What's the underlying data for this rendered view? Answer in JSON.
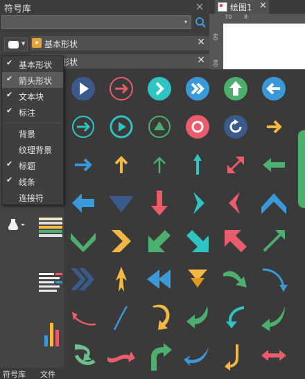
{
  "panel": {
    "title": "符号库",
    "close": "✕"
  },
  "search": {
    "placeholder": "",
    "dropdown": "▾"
  },
  "libraries": [
    {
      "label": "基本形状",
      "close": "✕"
    },
    {
      "label": "箭头形状",
      "close": "✕"
    }
  ],
  "menu": {
    "items": [
      {
        "label": "基本形状",
        "check": "✔"
      },
      {
        "label": "箭头形状",
        "check": "✔"
      },
      {
        "label": "文本块",
        "check": "✔"
      },
      {
        "label": "标注",
        "check": "✔"
      },
      {
        "label": "背景",
        "check": ""
      },
      {
        "label": "纹理背景",
        "check": ""
      },
      {
        "label": "标题",
        "check": "✔"
      },
      {
        "label": "线条",
        "check": "✔"
      },
      {
        "label": "连接符",
        "check": ""
      }
    ]
  },
  "doc": {
    "tab_label": "绘图1",
    "tab_close": "✕",
    "ruler_top": [
      "70",
      "8"
    ],
    "ruler_left": [
      "60",
      "80"
    ]
  },
  "bottom_tabs": [
    "符号库",
    "文件"
  ],
  "colors": {
    "teal": "#2ec4c4",
    "red": "#e85c6c",
    "green": "#4caf6e",
    "blue": "#3a9ad9",
    "yellow": "#f4b942",
    "navy": "#3a5a8c"
  },
  "symbols": [
    "play-circle-icon",
    "chevron-right-circle-outline-icon",
    "chevron-right-circle-icon",
    "double-chevron-circle-icon",
    "arrow-up-circle-icon",
    "arrow-left-circle-icon",
    "arrow-right-circle-outline-icon",
    "play-circle-outline-icon",
    "triangle-up-circle-icon",
    "refresh-circle-icon",
    "rotate-circle-icon",
    "chevron-right-icon",
    "arrow-right-icon",
    "arrow-up-icon",
    "arrow-up-thin-icon",
    "arrow-up-double-ended-icon",
    "arrow-diagonal-double-icon",
    "arrow-left-bold-icon",
    "arrow-left-block-icon",
    "triangle-down-icon",
    "arrow-down-block-icon",
    "chevron-right-thin-icon",
    "chevron-left-thin-icon",
    "chevron-up-block-icon",
    "chevron-down-block-icon",
    "chevron-right-block-icon",
    "arrow-down-left-block-icon",
    "arrow-down-right-block-icon",
    "arrow-up-left-block-icon",
    "arrow-up-right-thin-icon",
    "double-chevron-right-icon",
    "arrow-up-spike-icon",
    "double-triangle-left-icon",
    "triangle-down-double-icon",
    "curved-arrow-down-right-icon",
    "curved-arrow-down-thin-icon",
    "curved-arrow-left-icon",
    "curved-line-up-icon",
    "uturn-arrow-icon",
    "curved-arrow-down-left-icon",
    "curved-arrow-left-teal-icon",
    "curved-arrow-down-left-green-icon",
    "curved-arrow-down-green-icon",
    "curved-band-arrow-icon",
    "curved-up-right-arrow-icon",
    "curved-arrow-down-blue-icon",
    "curved-arrow-down-teal-icon",
    "double-arrow-horizontal-icon"
  ]
}
